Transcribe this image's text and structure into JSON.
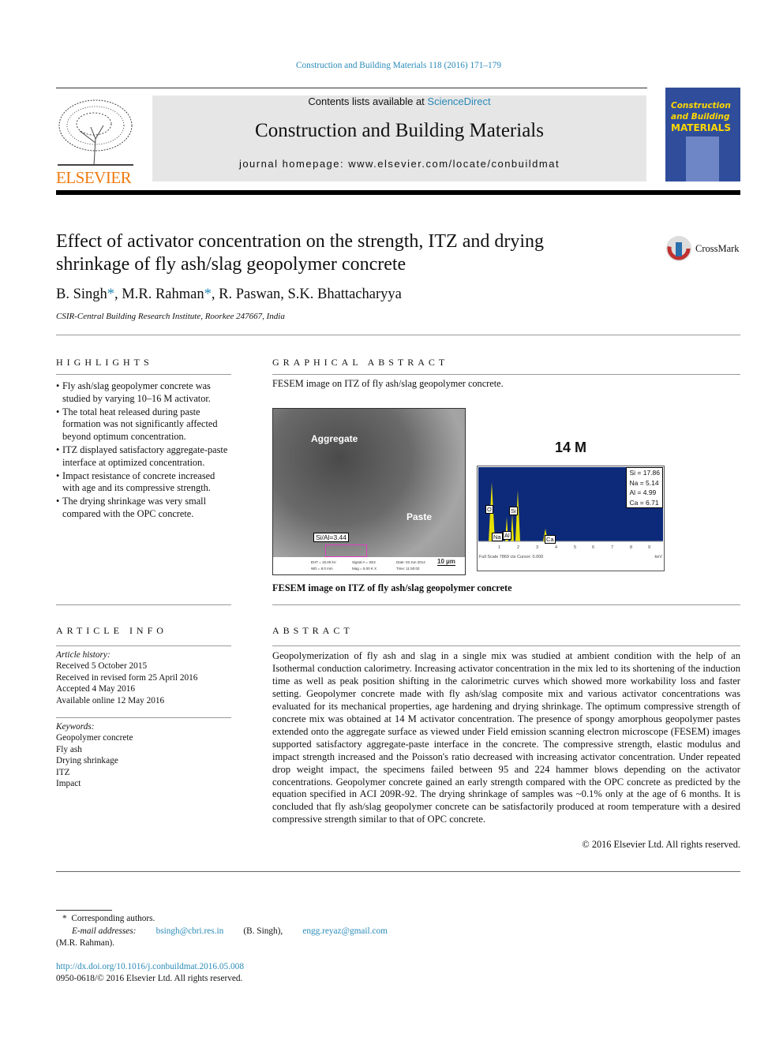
{
  "citation": "Construction and Building Materials 118 (2016) 171–179",
  "header": {
    "contents_prefix": "Contents lists available at ",
    "sciencedirect": "ScienceDirect",
    "journal": "Construction and Building Materials",
    "homepage": "journal homepage: www.elsevier.com/locate/conbuildmat",
    "publisher": "ELSEVIER",
    "cover_title": [
      "Construction",
      "and Building",
      "MATERIALS"
    ]
  },
  "article": {
    "title_line1": "Effect of activator concentration on the strength, ITZ and drying",
    "title_line2": "shrinkage of fly ash/slag geopolymer concrete",
    "crossmark": "CrossMark",
    "authors": [
      {
        "name": "B. Singh",
        "mark": "*"
      },
      {
        "name": "M.R. Rahman",
        "mark": "*"
      },
      {
        "name": "R. Paswan, S.K. Bhattacharyya",
        "mark": ""
      }
    ],
    "affiliation": "CSIR-Central Building Research Institute, Roorkee 247667, India"
  },
  "highlights": {
    "heading": "HIGHLIGHTS",
    "items": [
      "Fly ash/slag geopolymer concrete was studied by varying 10–16 M activator.",
      "The total heat released during paste formation was not significantly affected beyond optimum concentration.",
      "ITZ displayed satisfactory aggregate-paste interface at optimized concentration.",
      "Impact resistance of concrete increased with age and its compressive strength.",
      "The drying shrinkage was very small compared with the OPC concrete."
    ]
  },
  "graphical_abstract": {
    "heading": "GRAPHICAL ABSTRACT",
    "intro": "FESEM image on ITZ of fly ash/slag geopolymer concrete.",
    "caption": "FESEM image on ITZ of fly ash/slag geopolymer concrete",
    "sem": {
      "label_aggregate": "Aggregate",
      "label_paste": "Paste",
      "ratio": "Si/Al=3.44",
      "scale": "10 µm",
      "meta": [
        "EHT = 15.00 kV",
        "WD = 8.0 mm",
        "Signal A = SE2",
        "Mag = 5.00 K X",
        "Date: 03 Jun 2014",
        "Time: 11:50:02"
      ]
    },
    "eds": {
      "title": "14 M",
      "values": [
        "Si = 17.86",
        "Na = 5.14",
        "Al = 4.99",
        "Ca = 6.71"
      ],
      "peaks": [
        "O",
        "Si",
        "Na",
        "Al",
        "Ca"
      ],
      "ticks": [
        "1",
        "2",
        "3",
        "4",
        "5",
        "6",
        "7",
        "8",
        "9"
      ],
      "footer": "Full Scale 7869 cts Cursor: 0.000",
      "unit": "keV",
      "bg": "#0d2a7a",
      "peak_color": "#e8e000"
    }
  },
  "article_info": {
    "heading": "ARTICLE INFO",
    "history_label": "Article history:",
    "history": [
      "Received 5 October 2015",
      "Received in revised form 25 April 2016",
      "Accepted 4 May 2016",
      "Available online 12 May 2016"
    ],
    "keywords_label": "Keywords:",
    "keywords": [
      "Geopolymer concrete",
      "Fly ash",
      "Drying shrinkage",
      "ITZ",
      "Impact"
    ]
  },
  "abstract": {
    "heading": "ABSTRACT",
    "text": "Geopolymerization of fly ash and slag in a single mix was studied at ambient condition with the help of an Isothermal conduction calorimetry. Increasing activator concentration in the mix led to its shortening of the induction time as well as peak position shifting in the calorimetric curves which showed more workability loss and faster setting. Geopolymer concrete made with fly ash/slag composite mix and various activator concentrations was evaluated for its mechanical properties, age hardening and drying shrinkage. The optimum compressive strength of concrete mix was obtained at 14 M activator concentration. The presence of spongy amorphous geopolymer pastes extended onto the aggregate surface as viewed under Field emission scanning electron microscope (FESEM) images supported satisfactory aggregate-paste interface in the concrete. The compressive strength, elastic modulus and impact strength increased and the Poisson's ratio decreased with increasing activator concentration. Under repeated drop weight impact, the specimens failed between 95 and 224 hammer blows depending on the activator concentrations. Geopolymer concrete gained an early strength compared with the OPC concrete as predicted by the equation specified in ACI 209R-92. The drying shrinkage of samples was ~0.1% only at the age of 6 months. It is concluded that fly ash/slag geopolymer concrete can be satisfactorily produced at room temperature with a desired compressive strength similar to that of OPC concrete.",
    "copyright": "© 2016 Elsevier Ltd. All rights reserved."
  },
  "footnotes": {
    "corresponding": "Corresponding authors.",
    "star": "*",
    "email_label": "E-mail addresses:",
    "email1": "bsingh@cbri.res.in",
    "email1_name": "(B. Singh),",
    "email2": "engg.reyaz@gmail.com",
    "email2_name": "(M.R. Rahman).",
    "doi": "http://dx.doi.org/10.1016/j.conbuildmat.2016.05.008",
    "issn": "0950-0618/© 2016 Elsevier Ltd. All rights reserved."
  },
  "colors": {
    "link": "#2a8ab8",
    "elsevier_orange": "#f07a10",
    "cover_blue": "#2f4d9a",
    "cover_yellow": "#ffd800"
  }
}
